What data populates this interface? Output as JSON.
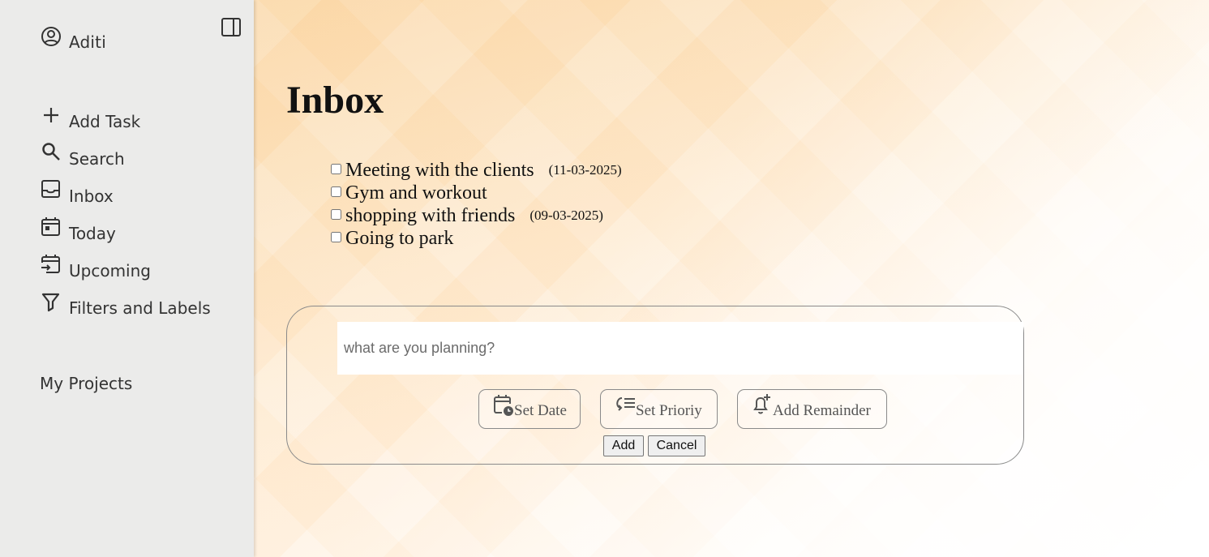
{
  "sidebar": {
    "user_name": "Aditi",
    "nav": [
      {
        "label": "Add Task",
        "icon": "plus-icon"
      },
      {
        "label": "Search",
        "icon": "search-icon"
      },
      {
        "label": "Inbox",
        "icon": "inbox-icon"
      },
      {
        "label": "Today",
        "icon": "calendar-today-icon"
      },
      {
        "label": "Upcoming",
        "icon": "calendar-upcoming-icon"
      },
      {
        "label": "Filters and Labels",
        "icon": "filter-icon"
      }
    ],
    "projects_heading": "My Projects"
  },
  "main": {
    "title": "Inbox",
    "tasks": [
      {
        "title": "Meeting with the clients",
        "date": "(11-03-2025)",
        "done": false
      },
      {
        "title": "Gym and workout",
        "date": "",
        "done": false
      },
      {
        "title": "shopping with friends",
        "date": "(09-03-2025)",
        "done": false
      },
      {
        "title": "Going to park",
        "date": "",
        "done": false
      }
    ],
    "composer": {
      "placeholder": "what are you planning?",
      "value": "",
      "set_date_label": "Set Date",
      "set_priority_label": "Set Prioriy",
      "add_reminder_label": "Add Remainder",
      "add_label": "Add",
      "cancel_label": "Cancel"
    }
  },
  "colors": {
    "sidebar_bg": "#ebebea",
    "accent_gradient_start": "#fbd8a8"
  }
}
